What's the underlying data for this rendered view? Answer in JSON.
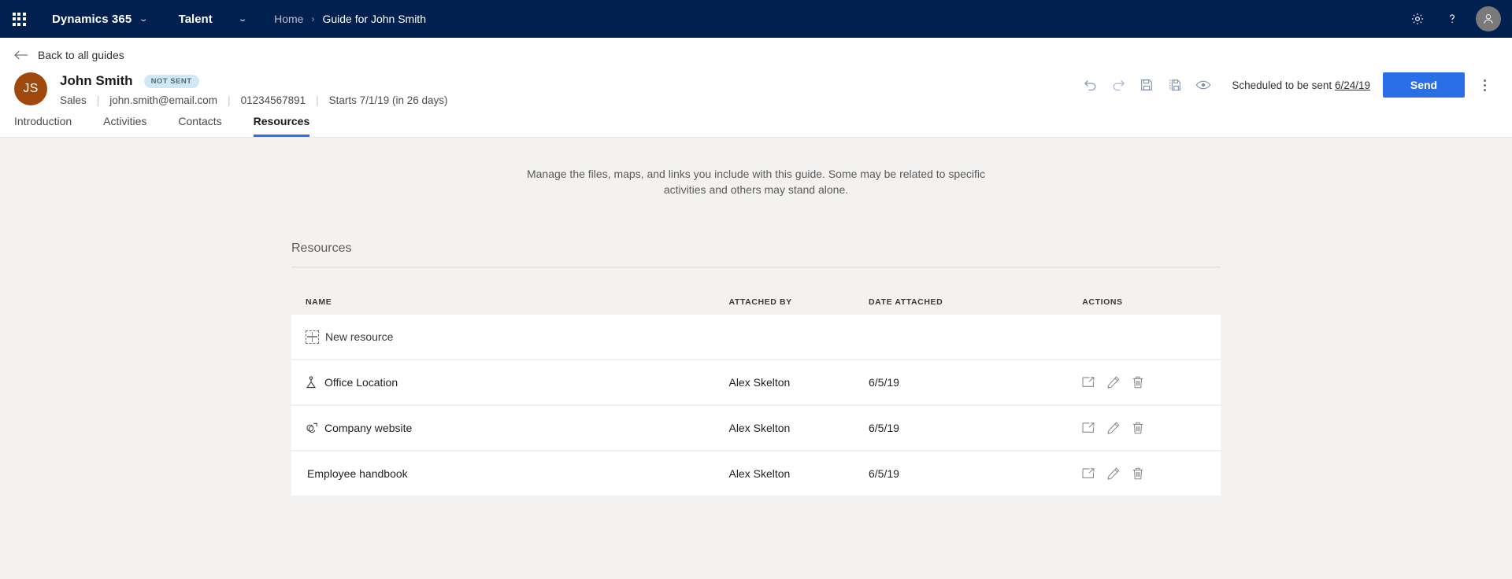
{
  "topbar": {
    "waffle_label": "app-launcher",
    "brand": "Dynamics 365",
    "app_name": "Talent",
    "breadcrumb_home": "Home",
    "breadcrumb_separator": "›",
    "breadcrumb_current": "Guide for John Smith",
    "settings_icon": "gear-icon",
    "help_icon": "question-mark-icon",
    "account_icon": "person-icon",
    "background_color": "#002050"
  },
  "subheader": {
    "back_label": "Back to all guides",
    "avatar_initials": "JS",
    "avatar_color": "#a0490d",
    "person_name": "John Smith",
    "status_badge": "NOT SENT",
    "badge_color": "#cfe8f5",
    "meta": {
      "department": "Sales",
      "email": "john.smith@email.com",
      "phone": "01234567891",
      "start": "Starts 7/1/19 (in 26 days)",
      "separator": "|"
    },
    "actions": {
      "undo": "undo-icon",
      "redo": "redo-icon",
      "save": "save-icon",
      "save_as": "save-as-icon",
      "preview": "preview-eye-icon",
      "scheduled_text": "Scheduled to be sent",
      "scheduled_date": "6/24/19",
      "send_label": "Send",
      "send_color": "#2b6fe8",
      "more_label": "more-options"
    }
  },
  "tabs": [
    {
      "label": "Introduction",
      "active": false
    },
    {
      "label": "Activities",
      "active": false
    },
    {
      "label": "Contacts",
      "active": false
    },
    {
      "label": "Resources",
      "active": true
    }
  ],
  "main": {
    "intro": "Manage the files, maps, and links you include with this guide. Some may be related to specific activities and others may stand alone.",
    "panel_title": "Resources",
    "columns": [
      "NAME",
      "ATTACHED BY",
      "DATE ATTACHED",
      "ACTIONS"
    ],
    "new_resource_label": "New resource",
    "rows": [
      {
        "name": "Office Location",
        "icon": "map-pin-icon",
        "attached_by": "Alex Skelton",
        "date": "6/5/19"
      },
      {
        "name": "Company website",
        "icon": "link-icon",
        "attached_by": "Alex Skelton",
        "date": "6/5/19"
      },
      {
        "name": "Employee handbook",
        "icon": "none",
        "attached_by": "Alex Skelton",
        "date": "6/5/19"
      }
    ],
    "row_actions": {
      "open": "open-in-new-icon",
      "edit": "edit-pencil-icon",
      "delete": "trash-icon"
    }
  }
}
